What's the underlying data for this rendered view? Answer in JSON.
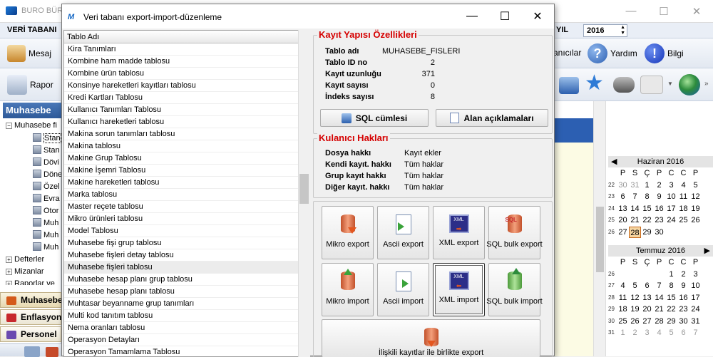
{
  "background_app": {
    "title": "BURO BÜR",
    "menu_left": "VERİ TABANI",
    "year_label": "YIL",
    "year_value": "2016",
    "toolbar1": {
      "mesaj": "Mesaj",
      "kullanicilar": "anıcılar",
      "yardim": "Yardım",
      "bilgi": "Bilgi"
    },
    "toolbar2": {
      "rapor": "Rapor"
    },
    "left_header": "Muhasebe",
    "tree": {
      "root": "Muhasebe fi",
      "children": [
        "Stan",
        "Stan",
        "Dövi",
        "Döne",
        "Özel",
        "Evra",
        "Otor",
        "Muh",
        "Muh",
        "Muh"
      ],
      "others": [
        "Defterler",
        "Mizanlar",
        "Raporlar ve"
      ]
    },
    "nav": [
      "Muhasebe",
      "Enflasyon",
      "Personel"
    ]
  },
  "calendar": {
    "june": {
      "title": "Haziran 2016",
      "days_header": [
        "P",
        "S",
        "Ç",
        "P",
        "C",
        "C",
        "P"
      ],
      "weeks": [
        {
          "wk": "22",
          "days": [
            "30",
            "31",
            "1",
            "2",
            "3",
            "4",
            "5"
          ]
        },
        {
          "wk": "23",
          "days": [
            "6",
            "7",
            "8",
            "9",
            "10",
            "11",
            "12"
          ]
        },
        {
          "wk": "24",
          "days": [
            "13",
            "14",
            "15",
            "16",
            "17",
            "18",
            "19"
          ]
        },
        {
          "wk": "25",
          "days": [
            "20",
            "21",
            "22",
            "23",
            "24",
            "25",
            "26"
          ]
        },
        {
          "wk": "26",
          "days": [
            "27",
            "28",
            "29",
            "30",
            "",
            "",
            ""
          ]
        }
      ],
      "today": "28"
    },
    "july": {
      "title": "Temmuz 2016",
      "days_header": [
        "P",
        "S",
        "Ç",
        "P",
        "C",
        "C",
        "P"
      ],
      "weeks": [
        {
          "wk": "26",
          "days": [
            "",
            "",
            "",
            "",
            "1",
            "2",
            "3"
          ]
        },
        {
          "wk": "27",
          "days": [
            "4",
            "5",
            "6",
            "7",
            "8",
            "9",
            "10"
          ]
        },
        {
          "wk": "28",
          "days": [
            "11",
            "12",
            "13",
            "14",
            "15",
            "16",
            "17"
          ]
        },
        {
          "wk": "29",
          "days": [
            "18",
            "19",
            "20",
            "21",
            "22",
            "23",
            "24"
          ]
        },
        {
          "wk": "30",
          "days": [
            "25",
            "26",
            "27",
            "28",
            "29",
            "30",
            "31"
          ]
        },
        {
          "wk": "31",
          "days": [
            "1",
            "2",
            "3",
            "4",
            "5",
            "6",
            "7"
          ]
        }
      ]
    }
  },
  "dialog": {
    "title": "Veri tabanı export-import-düzenleme",
    "list_header": "Tablo Adı",
    "tables": [
      "Kira Tanımları",
      "Kombine ham madde tablosu",
      "Kombine ürün tablosu",
      "Konsinye hareketleri kayıtları tablosu",
      "Kredi Kartları Tablosu",
      "Kullanıcı Tanımları Tablosu",
      "Kullanıcı hareketleri tablosu",
      "Makina sorun tanımları tablosu",
      "Makina tablosu",
      "Makine Grup Tablosu",
      "Makine İşemri Tablosu",
      "Makine hareketleri tablosu",
      "Marka tablosu",
      "Master reçete tablosu",
      "Mikro ürünleri tablosu",
      "Model Tablosu",
      "Muhasebe fişi grup tablosu",
      "Muhasebe fişleri detay tablosu",
      "Muhasebe fişleri tablosu",
      "Muhasebe hesap planı grup tablosu",
      "Muhasebe hesap planı tablosu",
      "Muhtasar beyanname grup tanımları",
      "Multi kod tanıtım tablosu",
      "Nema oranları tablosu",
      "Operasyon Detayları",
      "Operasyon Tamamlama Tablosu"
    ],
    "selected_index": 18,
    "record_props": {
      "title": "Kayıt Yapısı Özellikleri",
      "rows": [
        {
          "label": "Tablo adı",
          "value": "MUHASEBE_FISLERI"
        },
        {
          "label": "Tablo ID no",
          "value": "2"
        },
        {
          "label": "Kayıt uzunluğu",
          "value": "371"
        },
        {
          "label": "Kayıt sayısı",
          "value": "0"
        },
        {
          "label": "İndeks sayısı",
          "value": "8"
        }
      ],
      "sql_button": "SQL cümlesi",
      "fields_button": "Alan açıklamaları"
    },
    "rights": {
      "title": "Kulanıcı Hakları",
      "rows": [
        {
          "label": "Dosya hakkı",
          "value": "Kayıt ekler"
        },
        {
          "label": "Kendi kayıt. hakkı",
          "value": "Tüm haklar"
        },
        {
          "label": "Grup kayıt hakkı",
          "value": "Tüm haklar"
        },
        {
          "label": "Diğer kayıt. hakkı",
          "value": "Tüm haklar"
        }
      ]
    },
    "actions": {
      "mikro_export": "Mikro export",
      "ascii_export": "Ascii export",
      "xml_export": "XML export",
      "sql_bulk_export": "SQL bulk export",
      "mikro_import": "Mikro import",
      "ascii_import": "Ascii import",
      "xml_import": "XML import",
      "sql_bulk_import": "SQL bulk import",
      "related_export": "İlişkili kayıtlar ile birlikte export",
      "xml_icon_text": "XML",
      "sql_icon_text": "SQL"
    }
  }
}
